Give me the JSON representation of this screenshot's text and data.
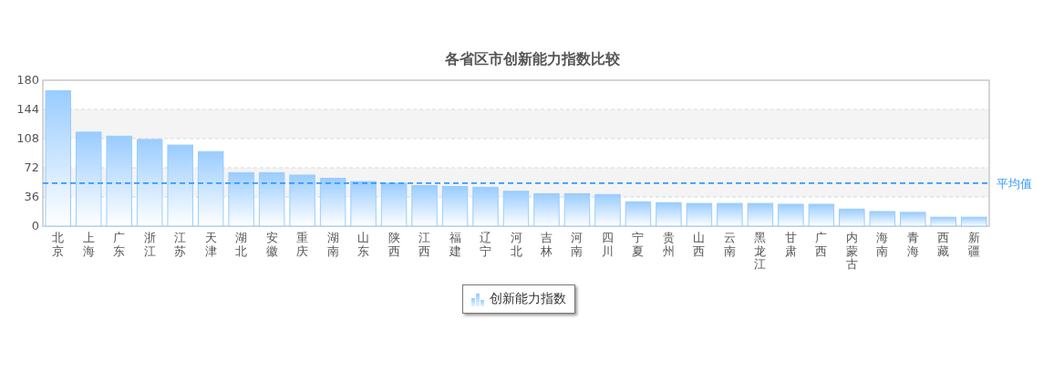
{
  "chart": {
    "chart_data": {
      "type": "bar",
      "title": "各省区市创新能力指数比较",
      "categories": [
        "北京",
        "上海",
        "广东",
        "浙江",
        "江苏",
        "天津",
        "湖北",
        "安徽",
        "重庆",
        "湖南",
        "山东",
        "陕西",
        "江西",
        "福建",
        "辽宁",
        "河北",
        "吉林",
        "河南",
        "四川",
        "宁夏",
        "贵州",
        "山西",
        "云南",
        "黑龙江",
        "甘肃",
        "广西",
        "内蒙古",
        "海南",
        "青海",
        "西藏",
        "新疆"
      ],
      "series": [
        {
          "name": "创新能力指数",
          "color": "#99ccff",
          "values": [
            167,
            116,
            111,
            107,
            100,
            92,
            66,
            66,
            63,
            59,
            55,
            53,
            50,
            49,
            48,
            43,
            40,
            40,
            39,
            30,
            29,
            28,
            28,
            28,
            27,
            27,
            21,
            18,
            17,
            11,
            11
          ]
        }
      ],
      "ylim": [
        0,
        180
      ],
      "yticks": [
        0,
        36,
        72,
        108,
        144,
        180
      ],
      "grid": true,
      "ref_lines": [
        {
          "axis": "y",
          "value": 53,
          "label": "平均值",
          "color": "#3399ff"
        }
      ]
    }
  }
}
